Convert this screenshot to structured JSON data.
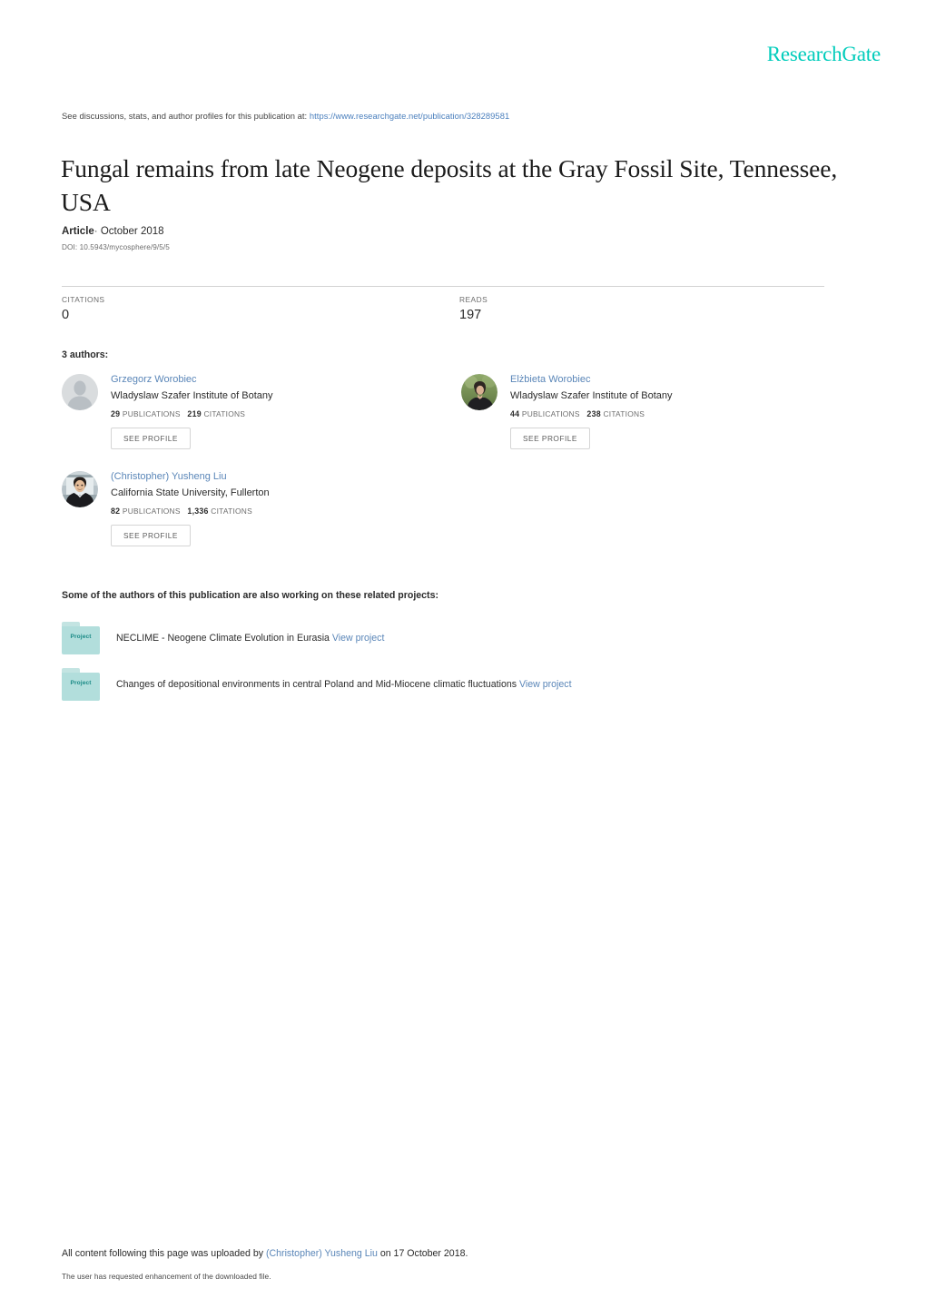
{
  "brand": {
    "logo_text": "ResearchGate",
    "accent_color": "#00ccbb",
    "link_color": "#5a86b8"
  },
  "discussions": {
    "prefix": "See discussions, stats, and author profiles for this publication at:",
    "url": "https://www.researchgate.net/publication/328289581"
  },
  "publication": {
    "title": "Fungal remains from late Neogene deposits at the Gray Fossil Site, Tennessee, USA",
    "type_label": "Article",
    "separator": "·",
    "date": "October 2018",
    "doi": "DOI: 10.5943/mycosphere/9/5/5"
  },
  "stats": {
    "citations_label": "CITATIONS",
    "citations_value": "0",
    "reads_label": "READS",
    "reads_value": "197"
  },
  "authors_section": {
    "heading": "3 authors:",
    "see_profile_label": "SEE PROFILE",
    "publications_label": "PUBLICATIONS",
    "citations_label": "CITATIONS",
    "authors": [
      {
        "name": "Grzegorz Worobiec",
        "affiliation": "Wladyslaw Szafer Institute of Botany",
        "publications": "29",
        "citations": "219",
        "avatar": "placeholder-person-avatar"
      },
      {
        "name": "Elżbieta Worobiec",
        "affiliation": "Wladyslaw Szafer Institute of Botany",
        "publications": "44",
        "citations": "238",
        "avatar": "photo-avatar-woman"
      },
      {
        "name": "(Christopher) Yusheng Liu",
        "affiliation": "California State University, Fullerton",
        "publications": "82",
        "citations": "1,336",
        "avatar": "photo-avatar-man"
      }
    ]
  },
  "projects_section": {
    "heading": "Some of the authors of this publication are also working on these related projects:",
    "icon_label": "Project",
    "view_link_label": "View project",
    "projects": [
      {
        "title": "NECLIME - Neogene Climate Evolution in Eurasia"
      },
      {
        "title": "Changes of depositional environments in central Poland and Mid-Miocene climatic fluctuations"
      }
    ]
  },
  "footer": {
    "line1_prefix": "All content following this page was uploaded by",
    "uploader": "(Christopher) Yusheng Liu",
    "line1_suffix": "on 17 October 2018.",
    "line2": "The user has requested enhancement of the downloaded file."
  }
}
